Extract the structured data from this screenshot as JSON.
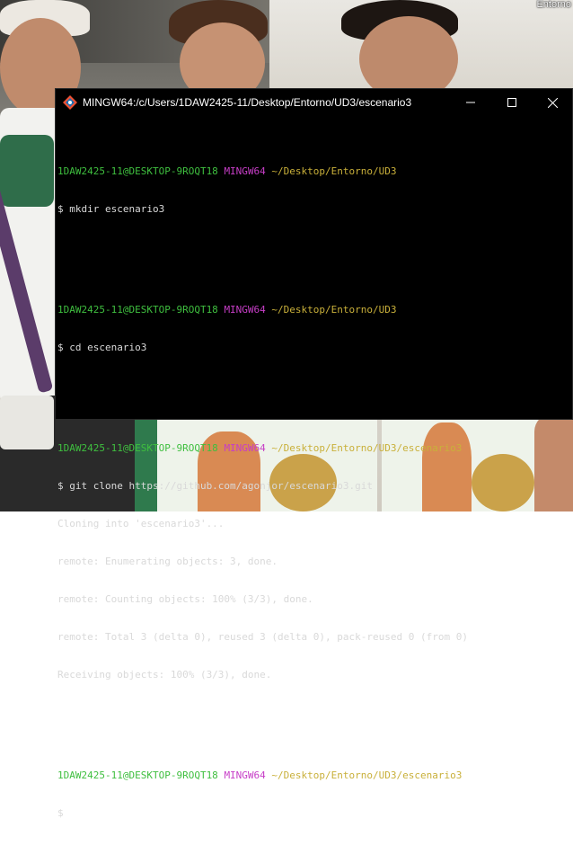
{
  "desktop": {
    "label": "Entorno"
  },
  "window": {
    "title": "MINGW64:/c/Users/1DAW2425-11/Desktop/Entorno/UD3/escenario3",
    "icon": "git-bash-icon",
    "controls": {
      "minimize": "—",
      "maximize": "☐",
      "close": "✕"
    }
  },
  "colors": {
    "prompt_user": "#3fbf3f",
    "prompt_env": "#c73ec7",
    "prompt_path": "#c9b03a",
    "output": "#d9d9d9",
    "background": "#000000"
  },
  "console": {
    "blocks": [
      {
        "user": "1DAW2425-11@DESKTOP-9ROQT18",
        "env": "MINGW64",
        "path": "~/Desktop/Entorno/UD3",
        "command": "$ mkdir escenario3",
        "output": []
      },
      {
        "user": "1DAW2425-11@DESKTOP-9ROQT18",
        "env": "MINGW64",
        "path": "~/Desktop/Entorno/UD3",
        "command": "$ cd escenario3",
        "output": []
      },
      {
        "user": "1DAW2425-11@DESKTOP-9ROQT18",
        "env": "MINGW64",
        "path": "~/Desktop/Entorno/UD3/escenario3",
        "command": "$ git clone https://github.com/agonjor/escenario3.git",
        "output": [
          "Cloning into 'escenario3'...",
          "remote: Enumerating objects: 3, done.",
          "remote: Counting objects: 100% (3/3), done.",
          "remote: Total 3 (delta 0), reused 3 (delta 0), pack-reused 0 (from 0)",
          "Receiving objects: 100% (3/3), done."
        ]
      },
      {
        "user": "1DAW2425-11@DESKTOP-9ROQT18",
        "env": "MINGW64",
        "path": "~/Desktop/Entorno/UD3/escenario3",
        "command": "$",
        "output": []
      }
    ]
  }
}
